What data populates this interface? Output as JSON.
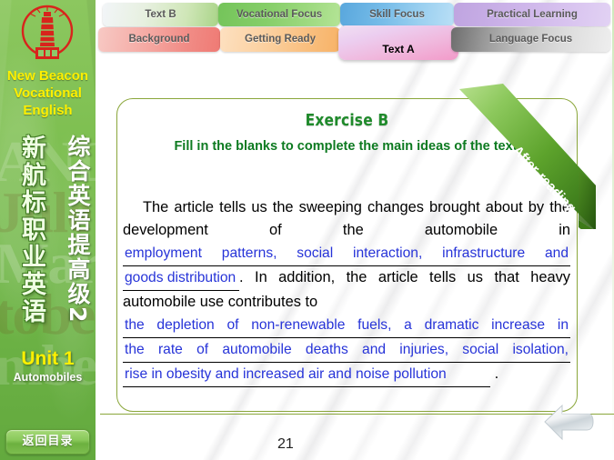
{
  "sidebar": {
    "logo_icon": "lighthouse-logo-icon",
    "brand_line1": "New Beacon",
    "brand_line2": "Vocational",
    "brand_line3": "English",
    "series_title_cn_left": "新航标职业英语",
    "series_title_cn_right": "综合英语提高级2",
    "unit": "Unit 1",
    "unit_subtitle": "Automobiles",
    "back_button": "返回目录"
  },
  "tabs": {
    "row1": [
      {
        "label": "Text B",
        "state": "inactive"
      },
      {
        "label": "Vocational Focus",
        "state": "inactive"
      },
      {
        "label": "Skill Focus",
        "state": "inactive"
      },
      {
        "label": "Practical Learning",
        "state": "inactive"
      }
    ],
    "row2": [
      {
        "label": "Background",
        "state": "inactive"
      },
      {
        "label": "Getting Ready",
        "state": "inactive"
      },
      {
        "label": "Text A",
        "state": "active"
      },
      {
        "label": "Language Focus",
        "state": "inactive"
      }
    ]
  },
  "ribbon": {
    "label": "After-reading",
    "color": "#5ea32a"
  },
  "main": {
    "exercise_title": "Exercise B",
    "instruction": "Fill in the blanks to complete the main ideas of the text.",
    "paragraph1_part1": "The article tells us the sweeping changes brought about by the development of the automobile in",
    "answer1_line1": "employment patterns, social interaction, infrastructure and",
    "answer1_line2": "goods distribution",
    "paragraph1_part2": ". In addition, the article tells us that heavy automobile use contributes to",
    "answer2_line1": "the depletion of non-renewable fuels, a dramatic increase in",
    "answer2_line2": "the rate of automobile deaths and injuries, social isolation,",
    "answer2_line3": "rise in obesity and increased air and noise pollution",
    "paragraph2_end": ".",
    "answer_color": "#2633d8",
    "title_color": "#1f8a2b"
  },
  "footer": {
    "page_number": "21",
    "nav_icon": "back-arrow-icon"
  }
}
